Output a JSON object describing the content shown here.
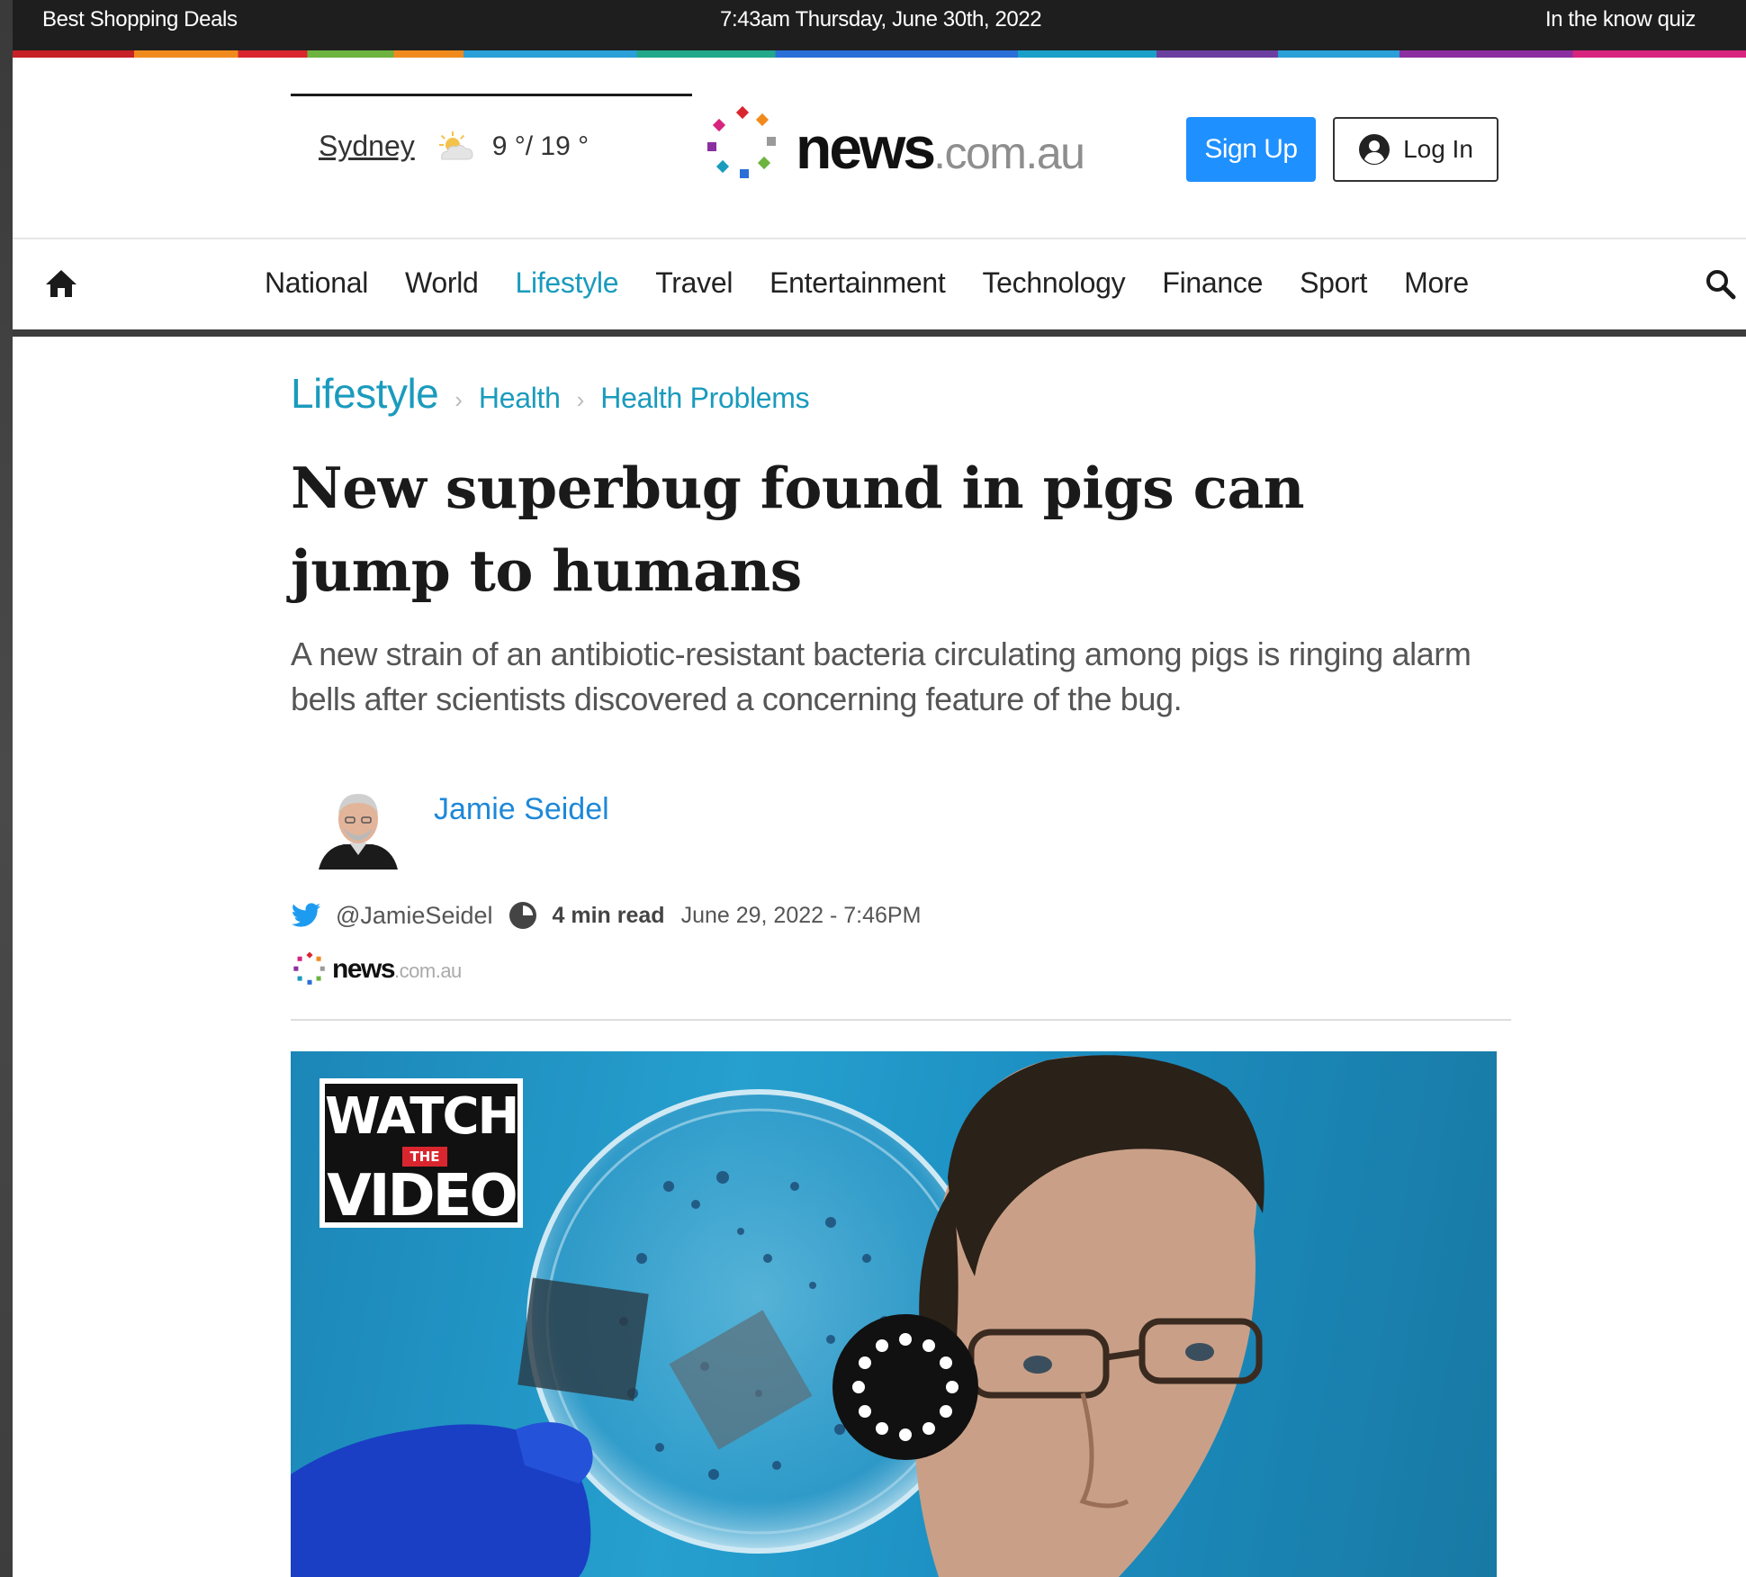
{
  "top_bar": {
    "left_link": "Best Shopping Deals",
    "datetime": "7:43am Thursday, June 30th, 2022",
    "right_link": "In the know quiz"
  },
  "header": {
    "weather": {
      "city": "Sydney",
      "temps": "9 °/ 19 °",
      "icon": "partly-sunny-icon"
    },
    "logo": {
      "brand": "news",
      "domain": ".com.au"
    },
    "signup_label": "Sign Up",
    "login_label": "Log In"
  },
  "nav": {
    "items": [
      {
        "label": "National"
      },
      {
        "label": "World"
      },
      {
        "label": "Lifestyle",
        "active": true
      },
      {
        "label": "Travel"
      },
      {
        "label": "Entertainment"
      },
      {
        "label": "Technology"
      },
      {
        "label": "Finance"
      },
      {
        "label": "Sport"
      },
      {
        "label": "More"
      }
    ]
  },
  "article": {
    "breadcrumb": [
      "Lifestyle",
      "Health",
      "Health Problems"
    ],
    "headline": "New superbug found in pigs can jump to humans",
    "standfirst": "A new strain of an antibiotic-resistant bacteria circulating among pigs is ringing alarm bells after scientists discovered a concerning feature of the bug.",
    "author": "Jamie Seidel",
    "twitter_handle": "@JamieSeidel",
    "read_time": "4 min read",
    "published": "June 29, 2022 - 7:46PM",
    "source_logo": {
      "brand": "news",
      "domain": ".com.au"
    }
  },
  "video": {
    "badge_top": "WATCH",
    "badge_mid": "THE",
    "badge_bottom": "VIDEO"
  },
  "colors": {
    "accent_teal": "#1a9bbd",
    "signup_blue": "#1e90ff",
    "author_blue": "#1e88d8",
    "top_strip": "#1e1e1e"
  }
}
